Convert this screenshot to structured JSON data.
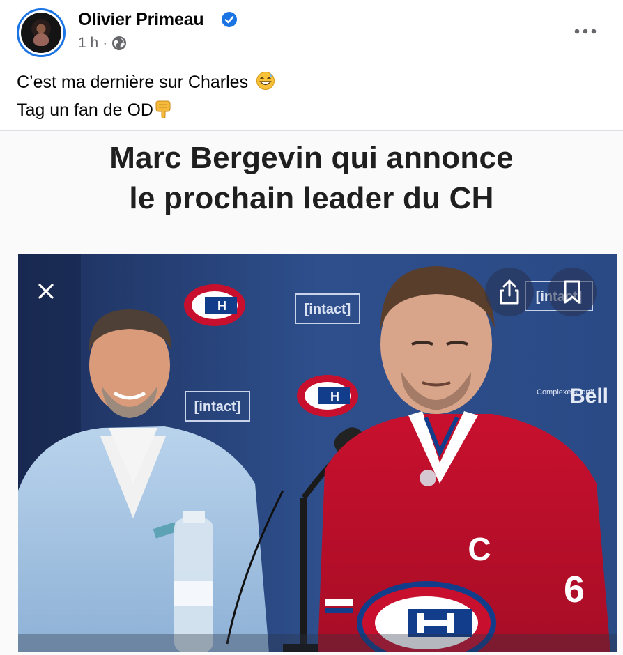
{
  "post": {
    "author": "Olivier Primeau",
    "time": "1 h",
    "separator": "·",
    "text_line1": "C’est ma dernière sur Charles",
    "text_line2": "Tag un fan de OD",
    "emoji1": "grinning-sweat-emoji",
    "emoji2": "pointing-down-emoji"
  },
  "meme": {
    "caption_line1": "Marc Bergevin qui annonce",
    "caption_line2": "le prochain leader du CH",
    "backdrop_text_intact": "[intact]",
    "backdrop_text_bell": "Bell",
    "backdrop_text_complexe": "Complexe sportif",
    "jersey_letter": "C",
    "jersey_number": "6"
  },
  "colors": {
    "verified": "#1b74e4",
    "meta": "#65676b",
    "divider": "#dcdfe3",
    "canadiens_red": "#c8102e",
    "backdrop_blue": "#2e4f8c",
    "suit_blue": "#a8c6e3"
  },
  "icons": {
    "verified": "verified-badge-icon",
    "globe": "globe-icon",
    "more": "more-options-icon",
    "close": "close-icon",
    "share": "share-icon",
    "save": "bookmark-icon"
  }
}
